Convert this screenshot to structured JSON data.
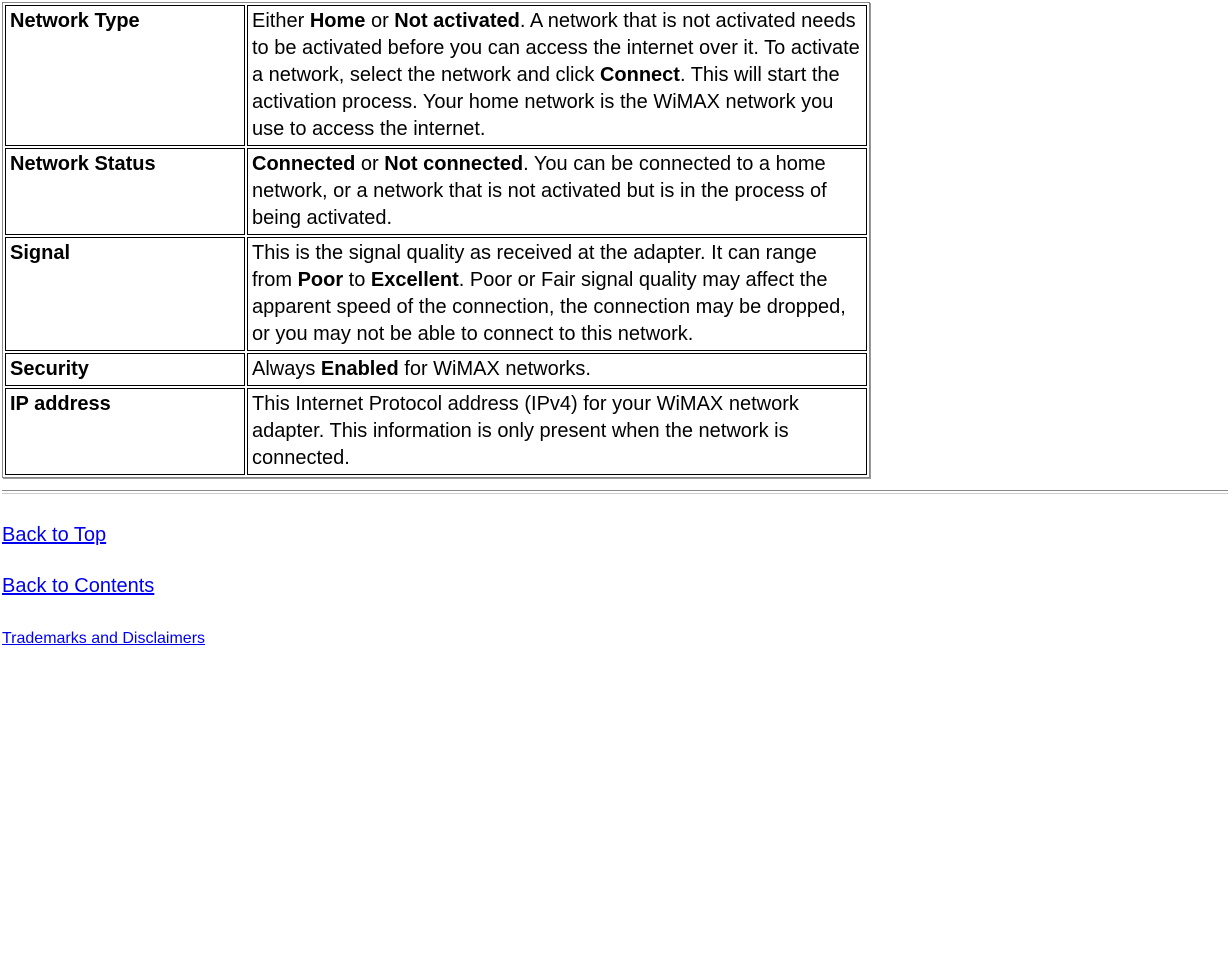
{
  "rows": [
    {
      "label": "Network Type",
      "desc_parts": [
        {
          "t": "Either "
        },
        {
          "t": "Home",
          "bold": true
        },
        {
          "t": " or "
        },
        {
          "t": "Not activated",
          "bold": true
        },
        {
          "t": ". A network that is not activated needs to be activated before you can access the internet over it. To activate a network, select the network and click "
        },
        {
          "t": "Connect",
          "bold": true
        },
        {
          "t": ". This will start the activation process. Your home network is the WiMAX network you use to access the internet."
        }
      ]
    },
    {
      "label": "Network Status",
      "desc_parts": [
        {
          "t": "Connected",
          "bold": true
        },
        {
          "t": " or "
        },
        {
          "t": "Not connected",
          "bold": true
        },
        {
          "t": ". You can be connected to a home network, or a network that is not activated but is in the process of being activated."
        }
      ]
    },
    {
      "label": "Signal",
      "desc_parts": [
        {
          "t": "This is the signal quality as received at the adapter. It can range from "
        },
        {
          "t": "Poor",
          "bold": true
        },
        {
          "t": " to "
        },
        {
          "t": "Excellent",
          "bold": true
        },
        {
          "t": ". Poor or Fair signal quality may affect the apparent speed of the connection, the connection may be dropped, or you may not be able to connect to this network."
        }
      ]
    },
    {
      "label": "Security",
      "desc_parts": [
        {
          "t": "Always "
        },
        {
          "t": "Enabled",
          "bold": true
        },
        {
          "t": " for WiMAX networks."
        }
      ]
    },
    {
      "label": "IP address",
      "desc_parts": [
        {
          "t": "This Internet Protocol address (IPv4) for your WiMAX network adapter. This information is only present when the network is connected."
        }
      ]
    }
  ],
  "links": {
    "back_to_top": "Back to Top",
    "back_to_contents": "Back to Contents",
    "trademarks": "Trademarks and Disclaimers"
  }
}
